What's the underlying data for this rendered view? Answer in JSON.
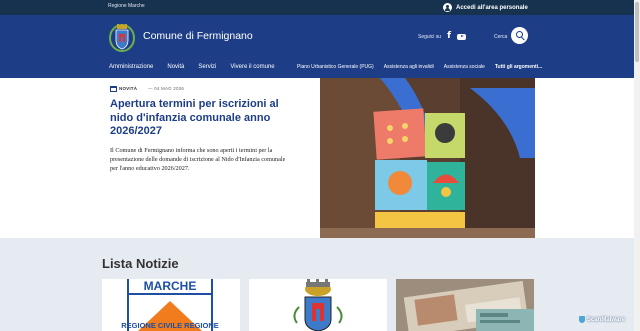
{
  "slim_header": {
    "region": "Regione Marche",
    "login_label": "Accedi all'area personale"
  },
  "header": {
    "site_title": "Comune di Fermignano",
    "follow_label": "Seguici su",
    "search_label": "Cerca",
    "nav_main": [
      "Amministrazione",
      "Novità",
      "Servizi",
      "Vivere il comune"
    ],
    "nav_secondary": [
      "Piano Urbanistico Generale (PUG)",
      "Assistenza agli invalidi",
      "Assistenza sociale"
    ],
    "nav_all": "Tutti gli argomenti..."
  },
  "hero": {
    "tag": "NOVITÀ",
    "date": "— 04 MAG 2026",
    "title": "Apertura termini per iscrizioni al nido d'infanzia comunale anno 2026/2027",
    "description": "Il Comune di Fermignano informa che sono aperti i termini per la presentazione delle domande di iscrizione al Nido d'Infanzia comunale per l'anno educativo 2026/2027."
  },
  "news_section": {
    "title": "Lista Notizie",
    "card1_image_text": [
      "MARCHE",
      "REGIONE CIVILE REGIONE"
    ]
  },
  "watermark": "ScanMalware",
  "colors": {
    "slim_bg": "#17324f",
    "header_bg": "#1d3e87",
    "title_blue": "#1d3e87",
    "news_bg": "#e6ebf2"
  }
}
